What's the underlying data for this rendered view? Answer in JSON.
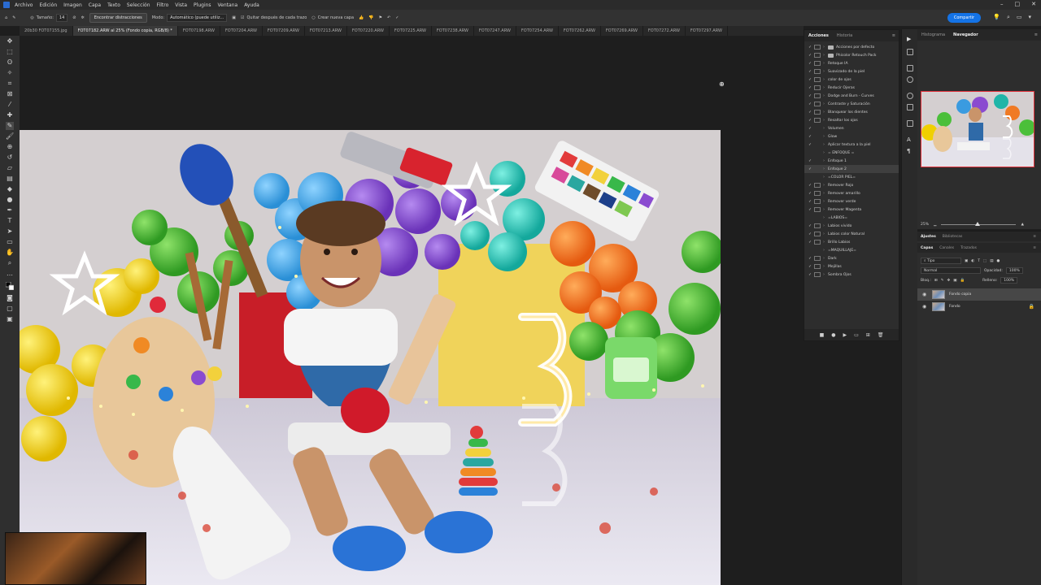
{
  "menubar": {
    "items": [
      "Archivo",
      "Edición",
      "Imagen",
      "Capa",
      "Texto",
      "Selección",
      "Filtro",
      "Vista",
      "Plugins",
      "Ventana",
      "Ayuda"
    ]
  },
  "optionsbar": {
    "size_label": "Tamaño:",
    "size_value": "14",
    "find_button": "Encontrar distracciones",
    "mode_label": "Modo:",
    "mode_value": "Automático (puede utiliz...",
    "remove_after_label": "Quitar después de cada trazo",
    "new_layer_label": "Crear nueva capa"
  },
  "share_button": "Compartir",
  "tabs": [
    "20b30 FOT07155.jpg",
    "FOT07182.ARW al 25% (Fondo copia, RGB/8) *",
    "FOT07198.ARW",
    "FOT07204.ARW",
    "FOT07209.ARW",
    "FOT07213.ARW",
    "FOT07220.ARW",
    "FOT07225.ARW",
    "FOT07238.ARW",
    "FOT07247.ARW",
    "FOT07254.ARW",
    "FOT07262.ARW",
    "FOT07269.ARW",
    "FOT07272.ARW",
    "FOT07297.ARW"
  ],
  "actions_panel": {
    "tabs": [
      "Acciones",
      "Historia"
    ],
    "rows": [
      {
        "label": "Acciones por defecto",
        "folder": true,
        "check": true,
        "box": true
      },
      {
        "label": "Phicolor Retouch Pack",
        "folder": true,
        "check": true,
        "box": true
      },
      {
        "label": "Retoque IA",
        "check": true,
        "box": true
      },
      {
        "label": "Suavizado de la piel",
        "check": true,
        "box": true
      },
      {
        "label": "color de ojos",
        "check": true,
        "box": true
      },
      {
        "label": "Reducir Ojeras",
        "check": true,
        "box": true
      },
      {
        "label": "Dodge and Burn - Curves",
        "check": true,
        "box": true
      },
      {
        "label": "Contraste y Saturación",
        "check": true,
        "box": true
      },
      {
        "label": "Blanquear los dientes",
        "check": true,
        "box": true
      },
      {
        "label": "Resaltar los ojos",
        "check": true,
        "box": true
      },
      {
        "label": "Volumen",
        "check": true,
        "box": false
      },
      {
        "label": "Glow",
        "check": true,
        "box": false
      },
      {
        "label": "Aplicar textura a la piel",
        "check": true,
        "box": false
      },
      {
        "label": "= ENFOQUE =",
        "check": false,
        "box": false
      },
      {
        "label": "Enfoque 1",
        "check": true,
        "box": false
      },
      {
        "label": "Enfoque 2",
        "check": true,
        "box": false,
        "selected": true
      },
      {
        "label": "=COLOR PIEL=",
        "check": false,
        "box": false
      },
      {
        "label": "Remover Rojo",
        "check": true,
        "box": true
      },
      {
        "label": "Remover amarillo",
        "check": true,
        "box": true
      },
      {
        "label": "Remover verde",
        "check": true,
        "box": true
      },
      {
        "label": "Remover Magenta",
        "check": true,
        "box": true
      },
      {
        "label": "=LABIOS=",
        "check": false,
        "box": false
      },
      {
        "label": "Labios vivido",
        "check": true,
        "box": true
      },
      {
        "label": "Labios color Natural",
        "check": true,
        "box": true
      },
      {
        "label": "Brillo Labios",
        "check": true,
        "box": true
      },
      {
        "label": "=MAQUILLAJE=",
        "check": false,
        "box": false
      },
      {
        "label": "Dark",
        "check": true,
        "box": true
      },
      {
        "label": "Mejillas",
        "check": true,
        "box": true
      },
      {
        "label": "Sombra Ojos",
        "check": true,
        "box": true
      }
    ]
  },
  "navigator_panel": {
    "tabs": [
      "Histograma",
      "Navegador"
    ],
    "zoom_value": "25%"
  },
  "adjust_panel": {
    "tabs": [
      "Ajustes",
      "Bibliotecas"
    ]
  },
  "layers_panel": {
    "tabs": [
      "Capas",
      "Canales",
      "Trazados"
    ],
    "kind_label": "Tipo",
    "blend_mode": "Normal",
    "opacity_label": "Opacidad:",
    "opacity_value": "100%",
    "lock_label": "Bloq.:",
    "fill_label": "Relleno:",
    "fill_value": "100%",
    "layers": [
      {
        "name": "Fondo copia",
        "selected": true
      },
      {
        "name": "Fondo",
        "selected": false
      }
    ]
  },
  "colors": {
    "accent": "#1473e6",
    "selection_border": "#e0303a"
  },
  "icons": [
    "ps-logo",
    "home-icon",
    "brush-icon",
    "share-icon",
    "search-icon",
    "lightbulb-icon",
    "settings-icon"
  ]
}
